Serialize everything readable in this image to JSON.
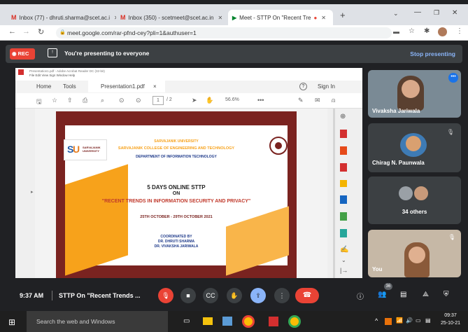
{
  "browser": {
    "tabs": [
      {
        "label": "Inbox (77) - dhruti.sharma@scet.ac.i"
      },
      {
        "label": "Inbox (350) - scetmeet@scet.ac.in"
      },
      {
        "label": "Meet - STTP On \"Recent Tre"
      }
    ],
    "url": "meet.google.com/rar-pfnd-cey?pli=1&authuser=1"
  },
  "banner": {
    "rec_label": "REC",
    "presenting_text": "You're presenting to everyone",
    "stop_label": "Stop presenting"
  },
  "pdf": {
    "menu": "File  Edit  View  Sign  Window  Help",
    "tab_home": "Home",
    "tab_tools": "Tools",
    "tab_doc": "Presentation1.pdf",
    "sign_in": "Sign In",
    "page_current": "1",
    "page_total": "/ 2",
    "zoom": "56.6%"
  },
  "slide": {
    "university": "SARVAJANIK UNIVERSITY",
    "college": "SARVAJANIK COLLEGE OF ENGINEERING AND TECHNOLOGY",
    "department": "DEPARTMENT OF INFORMATION TECHNOLOGY",
    "logo_text": "SARVAJANIK UNIVERSITY",
    "sttp_title": "5 DAYS ONLINE STTP",
    "on": "ON",
    "topic": "\"RECENT TRENDS IN INFORMATION SECURITY AND PRIVACY\"",
    "dates": "25TH OCTOBER - 29TH OCTOBER 2021",
    "coordinated": "COORDINATED BY",
    "coord1": "DR. DHRUTI SHARMA",
    "coord2": "DR. VIVAKSHA JARIWALA"
  },
  "participants": {
    "p1": "Vivaksha Jariwala",
    "p2": "Chirag N. Paunwala",
    "others": "34 others",
    "you": "You"
  },
  "controls": {
    "time": "9:37 AM",
    "meeting": "STTP On \"Recent Trends ...",
    "people_count": "36"
  },
  "taskbar": {
    "search": "Search the web and Windows",
    "clock_time": "09:37",
    "clock_date": "25-10-21"
  }
}
